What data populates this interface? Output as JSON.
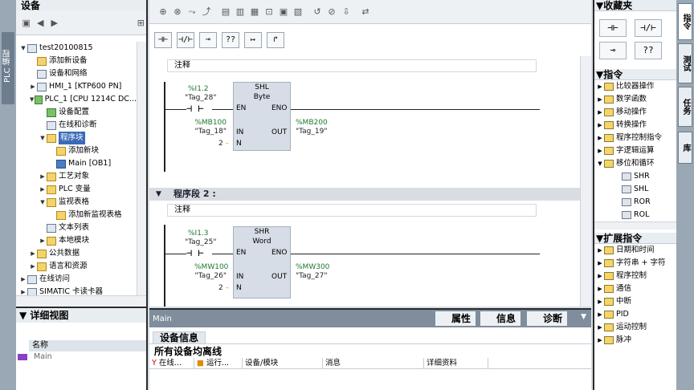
{
  "left_strip": {
    "tab_label": "PLC 编程"
  },
  "tree_panel": {
    "title": "设备",
    "items": [
      {
        "label": "test20100815",
        "indent": 0,
        "arrow": "▼",
        "icon": "project"
      },
      {
        "label": "添加新设备",
        "indent": 1,
        "arrow": "",
        "icon": "add"
      },
      {
        "label": "设备和网络",
        "indent": 1,
        "arrow": "",
        "icon": "network"
      },
      {
        "label": "HMI_1 [KTP600 PN]",
        "indent": 1,
        "arrow": "▶",
        "icon": "hmi"
      },
      {
        "label": "PLC_1 [CPU 1214C DC...",
        "indent": 1,
        "arrow": "▼",
        "icon": "plc"
      },
      {
        "label": "设备配置",
        "indent": 2,
        "arrow": "",
        "icon": "config"
      },
      {
        "label": "在线和诊断",
        "indent": 2,
        "arrow": "",
        "icon": "diag"
      },
      {
        "label": "程序块",
        "indent": 2,
        "arrow": "▼",
        "icon": "folder",
        "selected": true
      },
      {
        "label": "添加新块",
        "indent": 3,
        "arrow": "",
        "icon": "add"
      },
      {
        "label": "Main [OB1]",
        "indent": 3,
        "arrow": "",
        "icon": "block"
      },
      {
        "label": "工艺对象",
        "indent": 2,
        "arrow": "▶",
        "icon": "folder"
      },
      {
        "label": "PLC 变量",
        "indent": 2,
        "arrow": "▶",
        "icon": "folder"
      },
      {
        "label": "监视表格",
        "indent": 2,
        "arrow": "▼",
        "icon": "folder"
      },
      {
        "label": "添加新监视表格",
        "indent": 3,
        "arrow": "",
        "icon": "add"
      },
      {
        "label": "文本列表",
        "indent": 2,
        "arrow": "",
        "icon": "list"
      },
      {
        "label": "本地模块",
        "indent": 2,
        "arrow": "▶",
        "icon": "folder"
      },
      {
        "label": "公共数据",
        "indent": 1,
        "arrow": "▶",
        "icon": "folder"
      },
      {
        "label": "语言和资源",
        "indent": 1,
        "arrow": "▶",
        "icon": "folder"
      },
      {
        "label": "在线访问",
        "indent": 0,
        "arrow": "▶",
        "icon": "online"
      },
      {
        "label": "SIMATIC 卡读卡器",
        "indent": 0,
        "arrow": "▶",
        "icon": "card"
      }
    ]
  },
  "details_panel": {
    "title": "详细视图",
    "column_header": "名称",
    "rows": [
      {
        "label": "Main"
      }
    ]
  },
  "editor": {
    "networks": [
      {
        "comment_label": "注释",
        "contact": {
          "addr": "%I1.2",
          "tag": "\"Tag_28\""
        },
        "box": {
          "name": "SHL",
          "type": "Byte",
          "en": "EN",
          "eno": "ENO",
          "in": "IN",
          "out": "OUT",
          "n": "N"
        },
        "in_operand": {
          "addr": "%MB100",
          "tag": "\"Tag_18\""
        },
        "out_operand": {
          "addr": "%MB200",
          "tag": "\"Tag_19\""
        },
        "n_value": "2"
      },
      {
        "header": "程序段 2 :",
        "comment_label": "注释",
        "contact": {
          "addr": "%I1.3",
          "tag": "\"Tag_25\""
        },
        "box": {
          "name": "SHR",
          "type": "Word",
          "en": "EN",
          "eno": "ENO",
          "in": "IN",
          "out": "OUT",
          "n": "N"
        },
        "in_operand": {
          "addr": "%MW100",
          "tag": "\"Tag_26\""
        },
        "out_operand": {
          "addr": "%MW300",
          "tag": "\"Tag_27\""
        },
        "n_value": "2"
      }
    ],
    "instr_buttons": [
      "⊣⊢",
      "⊣/⊢",
      "⊸",
      "??",
      "↦",
      "↱"
    ]
  },
  "info_panel": {
    "title": "Main",
    "tabs": [
      "属性",
      "信息",
      "诊断"
    ],
    "subtab": "设备信息",
    "message": "所有设备均离线",
    "columns": [
      "在线...",
      "运行...",
      "设备/模块",
      "消息",
      "详细资料"
    ]
  },
  "right_panel": {
    "favorites_title": "收藏夹",
    "favorites": [
      "⊣⊢",
      "⊣/⊢",
      "⊸",
      "??"
    ],
    "instructions_title": "指令",
    "instructions": [
      {
        "label": "比较器操作",
        "arrow": "▶"
      },
      {
        "label": "数学函数",
        "arrow": "▶"
      },
      {
        "label": "移动操作",
        "arrow": "▶"
      },
      {
        "label": "转换操作",
        "arrow": "▶"
      },
      {
        "label": "程序控制指令",
        "arrow": "▶"
      },
      {
        "label": "字逻辑运算",
        "arrow": "▶"
      },
      {
        "label": "移位和循环",
        "arrow": "▼"
      },
      {
        "label": "SHR",
        "arrow": "",
        "child": true
      },
      {
        "label": "SHL",
        "arrow": "",
        "child": true
      },
      {
        "label": "ROR",
        "arrow": "",
        "child": true
      },
      {
        "label": "ROL",
        "arrow": "",
        "child": true
      }
    ],
    "extended_title": "扩展指令",
    "extended": [
      {
        "label": "日期和时间"
      },
      {
        "label": "字符串 + 字符"
      },
      {
        "label": "程序控制"
      },
      {
        "label": "通信"
      },
      {
        "label": "中断"
      },
      {
        "label": "PID"
      },
      {
        "label": "运动控制"
      },
      {
        "label": "脉冲"
      }
    ]
  },
  "right_strip": {
    "tabs": [
      "指令",
      "测试",
      "任务",
      "库"
    ]
  }
}
